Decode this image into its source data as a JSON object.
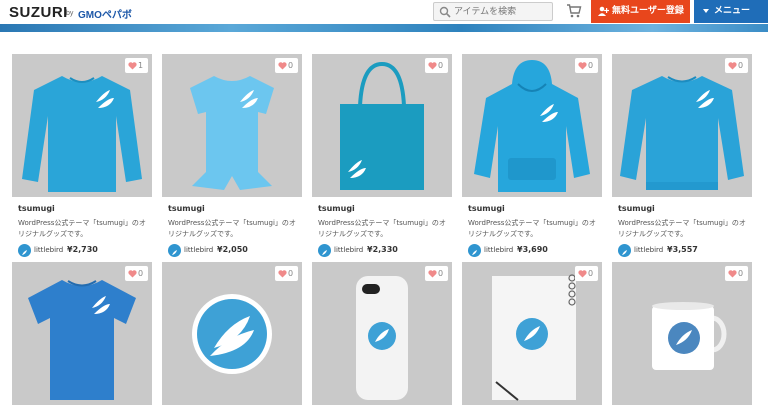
{
  "header": {
    "logo": "SUZURI",
    "logo_by": "by",
    "logo_partner": "GMOペパボ",
    "search_placeholder": "アイテムを検索",
    "signup_label": "無料ユーザー登録",
    "menu_label": "メニュー"
  },
  "colors": {
    "accent_signup": "#e8461c",
    "accent_menu": "#1f6db8",
    "card_background": "#c9c9c9"
  },
  "products": [
    {
      "product": "long-sleeve-tshirt",
      "likes": "1",
      "name": "tsumugi",
      "desc": "WordPress公式テーマ「tsumugi」のオリジナルグッズです。",
      "seller": "littlebird",
      "price": "¥2,730",
      "color": "#2aa5d8"
    },
    {
      "product": "baby-rompers",
      "likes": "0",
      "name": "tsumugi",
      "desc": "WordPress公式テーマ「tsumugi」のオリジナルグッズです。",
      "seller": "littlebird",
      "price": "¥2,050",
      "color": "#6cc6ef"
    },
    {
      "product": "tote-bag",
      "likes": "0",
      "name": "tsumugi",
      "desc": "WordPress公式テーマ「tsumugi」のオリジナルグッズです。",
      "seller": "littlebird",
      "price": "¥2,330",
      "color": "#1b9cc0"
    },
    {
      "product": "hoodie",
      "likes": "0",
      "name": "tsumugi",
      "desc": "WordPress公式テーマ「tsumugi」のオリジナルグッズです。",
      "seller": "littlebird",
      "price": "¥3,690",
      "color": "#26a6dc"
    },
    {
      "product": "sweatshirt",
      "likes": "0",
      "name": "tsumugi",
      "desc": "WordPress公式テーマ「tsumugi」のオリジナルグッズです。",
      "seller": "littlebird",
      "price": "¥3,557",
      "color": "#2aa3d8"
    },
    {
      "product": "tshirt",
      "likes": "0",
      "color": "#2e7fcc"
    },
    {
      "product": "sticker",
      "likes": "0",
      "color": "#3ea1d6"
    },
    {
      "product": "iphone-case",
      "likes": "0",
      "color": "#f3f3f3"
    },
    {
      "product": "notebook",
      "likes": "0",
      "color": "#f5f5f5"
    },
    {
      "product": "mug",
      "likes": "0",
      "color": "#ffffff"
    }
  ]
}
